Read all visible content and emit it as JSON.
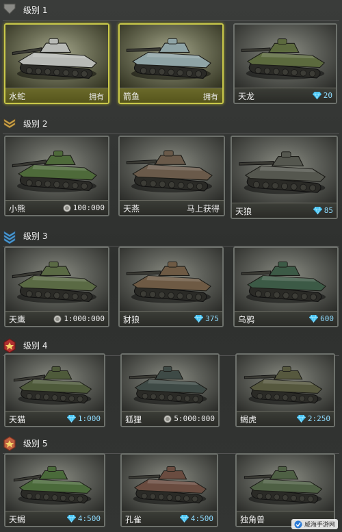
{
  "tiers": [
    {
      "label": "级别 1",
      "tanks": [
        {
          "name": "水蛇",
          "status": "拥有",
          "selected": true,
          "color": "#b8bab6"
        },
        {
          "name": "箭鱼",
          "status": "拥有",
          "selected": true,
          "color": "#8fa4a6"
        },
        {
          "name": "天龙",
          "price": "20",
          "currency": "gem",
          "color": "#5c6a3e"
        }
      ]
    },
    {
      "label": "级别 2",
      "tanks": [
        {
          "name": "小熊",
          "price": "100:000",
          "currency": "coin",
          "color": "#4e6a3a"
        },
        {
          "name": "天燕",
          "status": "马上获得",
          "color": "#6a5a4a"
        },
        {
          "name": "天狼",
          "price": "85",
          "currency": "gem",
          "color": "#55574f"
        }
      ]
    },
    {
      "label": "级别 3",
      "tanks": [
        {
          "name": "天鹰",
          "price": "1:000:000",
          "currency": "coin",
          "color": "#5a6a44"
        },
        {
          "name": "豺狼",
          "price": "375",
          "currency": "gem",
          "color": "#6e5a44"
        },
        {
          "name": "乌鸦",
          "price": "600",
          "currency": "gem",
          "color": "#3c5a46"
        }
      ]
    },
    {
      "label": "级别 4",
      "tanks": [
        {
          "name": "天猫",
          "price": "1:000",
          "currency": "gem",
          "color": "#4e5a3a"
        },
        {
          "name": "狐狸",
          "price": "5:000:000",
          "currency": "coin",
          "color": "#3e4a46"
        },
        {
          "name": "蝎虎",
          "price": "2:250",
          "currency": "gem",
          "color": "#56583e"
        }
      ]
    },
    {
      "label": "级别 5",
      "tanks": [
        {
          "name": "天蝎",
          "price": "4:500",
          "currency": "gem",
          "color": "#4a6a3a"
        },
        {
          "name": "孔雀",
          "price": "4:500",
          "currency": "gem",
          "color": "#6a4c40"
        },
        {
          "name": "独角兽",
          "price": "",
          "currency": "",
          "color": "#4e6044"
        }
      ]
    }
  ],
  "watermark": "威海手游网"
}
